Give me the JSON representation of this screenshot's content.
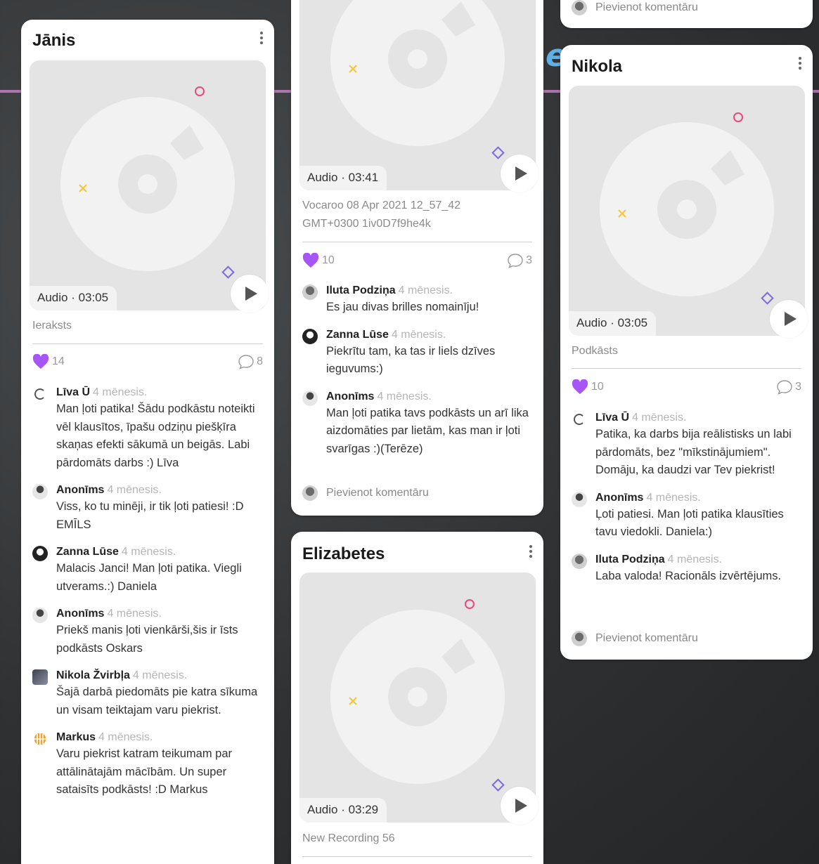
{
  "colors": {
    "accent": "#a855f7",
    "marker_pink": "#e84a7f",
    "marker_yellow": "#f6c63a",
    "marker_purple": "#7d6bd6"
  },
  "cards": {
    "janis": {
      "title": "Jānis",
      "media_label": "Audio · 03:05",
      "caption": "Ieraksts",
      "likes": "14",
      "comments_count": "8",
      "comments": [
        {
          "author": "Līva Ū",
          "time": "4 mēnesis.",
          "text": "Man ļoti patika! Šādu podkāstu noteikti vēl klausītos, īpašu odziņu piešķīra skaņas efekti sākumā un beigās. Labi pārdomāts darbs :) Līva"
        },
        {
          "author": "Anonīms",
          "time": "4 mēnesis.",
          "text": "Viss, ko tu minēji, ir tik ļoti patiesi! :D EMĪLS"
        },
        {
          "author": "Zanna Lūse",
          "time": "4 mēnesis.",
          "text": "Malacis Janci! Man ļoti patika. Viegli utverams.:) Daniela"
        },
        {
          "author": "Anonīms",
          "time": "4 mēnesis.",
          "text": "Priekš manis ļoti vienkārši,šis ir īsts podkāsts Oskars"
        },
        {
          "author": "Nikola Žvirbļa",
          "time": "4 mēnesis.",
          "text": "Šajā darbā piedomāts pie katra sīkuma un visam teiktajam varu piekrist."
        },
        {
          "author": "Markus",
          "time": "4 mēnesis.",
          "text": "Varu piekrist katram teikumam par attālinātajām mācībām. Un super sataisīts podkāsts! :D Markus"
        }
      ]
    },
    "middle_top": {
      "media_label": "Audio · 03:41",
      "caption": "Vocaroo 08 Apr 2021 12_57_42 GMT+0300 1iv0D7f9he4k",
      "likes": "10",
      "comments_count": "3",
      "comments": [
        {
          "author": "Iluta Podziņa",
          "time": "4 mēnesis.",
          "text": "Es jau divas brilles nomainīju!"
        },
        {
          "author": "Zanna Lūse",
          "time": "4 mēnesis.",
          "text": "Piekrītu tam, ka tas ir liels dzīves ieguvums:)"
        },
        {
          "author": "Anonīms",
          "time": "4 mēnesis.",
          "text": "Man ļoti patika tavs podkāsts un arī lika aizdomāties par lietām, kas man ir ļoti svarīgas :)(Terēze)"
        }
      ],
      "add_comment": "Pievienot komentāru"
    },
    "elizabetes": {
      "title": "Elizabetes",
      "media_label": "Audio · 03:29",
      "caption": "New Recording 56"
    },
    "right_top": {
      "add_comment": "Pievienot komentāru"
    },
    "nikola": {
      "title": "Nikola",
      "media_label": "Audio · 03:05",
      "caption": "Podkāsts",
      "likes": "10",
      "comments_count": "3",
      "comments": [
        {
          "author": "Līva Ū",
          "time": "4 mēnesis.",
          "text": "Patika, ka darbs bija reālistisks un labi pārdomāts, bez \"mīkstinājumiem\". Domāju, ka daudzi var Tev piekrist!"
        },
        {
          "author": "Anonīms",
          "time": "4 mēnesis.",
          "text": "Ļoti patiesi. Man ļoti patika klausīties tavu viedokli. Daniela:)"
        },
        {
          "author": "Iluta Podziņa",
          "time": "4 mēnesis.",
          "text": "Laba valoda! Racionāls izvērtējums."
        }
      ],
      "add_comment": "Pievienot komentāru"
    }
  }
}
